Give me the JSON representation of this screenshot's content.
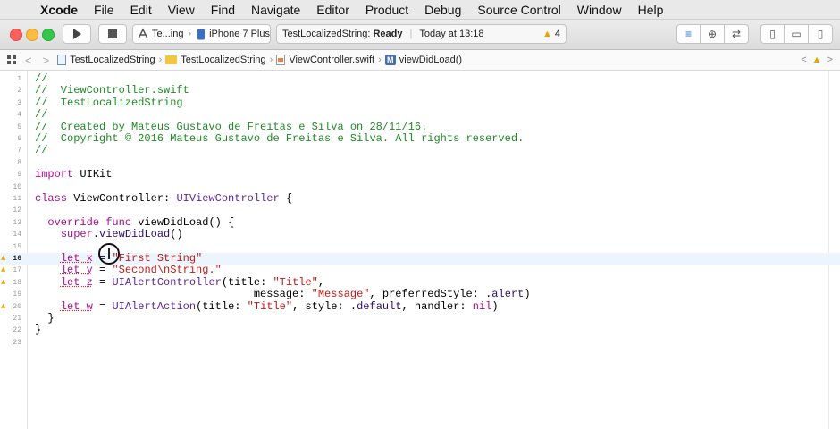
{
  "menubar": {
    "apple_glyph": "",
    "app": "Xcode",
    "items": [
      "File",
      "Edit",
      "View",
      "Find",
      "Navigate",
      "Editor",
      "Product",
      "Debug",
      "Source Control",
      "Window",
      "Help"
    ]
  },
  "toolbar": {
    "scheme": "Te...ing",
    "device": "iPhone 7 Plus",
    "status_project": "TestLocalizedString:",
    "status_state": "Ready",
    "status_time": "Today at 13:18",
    "warning_count": "4"
  },
  "jumpbar": {
    "crumbs": [
      "TestLocalizedString",
      "TestLocalizedString",
      "ViewController.swift",
      "viewDidLoad()"
    ],
    "method_icon_letter": "M",
    "back_glyph": "<",
    "forward_glyph": ">"
  },
  "editor": {
    "lines": [
      {
        "n": "1",
        "segs": [
          {
            "t": "//",
            "c": "com"
          }
        ]
      },
      {
        "n": "2",
        "segs": [
          {
            "t": "//  ViewController.swift",
            "c": "com"
          }
        ]
      },
      {
        "n": "3",
        "segs": [
          {
            "t": "//  TestLocalizedString",
            "c": "com"
          }
        ]
      },
      {
        "n": "4",
        "segs": [
          {
            "t": "//",
            "c": "com"
          }
        ]
      },
      {
        "n": "5",
        "segs": [
          {
            "t": "//  Created by Mateus Gustavo de Freitas e Silva on 28/11/16.",
            "c": "com"
          }
        ]
      },
      {
        "n": "6",
        "segs": [
          {
            "t": "//  Copyright © 2016 Mateus Gustavo de Freitas e Silva. All rights reserved.",
            "c": "com"
          }
        ]
      },
      {
        "n": "7",
        "segs": [
          {
            "t": "//",
            "c": "com"
          }
        ]
      },
      {
        "n": "8",
        "segs": []
      },
      {
        "n": "9",
        "segs": [
          {
            "t": "import",
            "c": "kw"
          },
          {
            "t": " UIKit",
            "c": ""
          }
        ]
      },
      {
        "n": "10",
        "segs": []
      },
      {
        "n": "11",
        "segs": [
          {
            "t": "class",
            "c": "kw"
          },
          {
            "t": " ViewController: ",
            "c": ""
          },
          {
            "t": "UIViewController",
            "c": "type"
          },
          {
            "t": " {",
            "c": ""
          }
        ]
      },
      {
        "n": "12",
        "segs": []
      },
      {
        "n": "13",
        "segs": [
          {
            "t": "  ",
            "c": ""
          },
          {
            "t": "override",
            "c": "kw"
          },
          {
            "t": " ",
            "c": ""
          },
          {
            "t": "func",
            "c": "kw"
          },
          {
            "t": " viewDidLoad() {",
            "c": ""
          }
        ]
      },
      {
        "n": "14",
        "segs": [
          {
            "t": "    ",
            "c": ""
          },
          {
            "t": "super",
            "c": "kw"
          },
          {
            "t": ".",
            "c": ""
          },
          {
            "t": "viewDidLoad",
            "c": "fn"
          },
          {
            "t": "()",
            "c": ""
          }
        ]
      },
      {
        "n": "15",
        "segs": []
      },
      {
        "n": "16",
        "warn": true,
        "cur": true,
        "segs": [
          {
            "t": "    ",
            "c": ""
          },
          {
            "t": "let x",
            "c": "kw sq"
          },
          {
            "t": " = ",
            "c": ""
          },
          {
            "t": "\"First String\"",
            "c": "str"
          }
        ]
      },
      {
        "n": "17",
        "warn": true,
        "segs": [
          {
            "t": "    ",
            "c": ""
          },
          {
            "t": "let y",
            "c": "kw sq"
          },
          {
            "t": " = ",
            "c": ""
          },
          {
            "t": "\"Second\\nString.\"",
            "c": "str"
          }
        ]
      },
      {
        "n": "18",
        "warn": true,
        "segs": [
          {
            "t": "    ",
            "c": ""
          },
          {
            "t": "let z",
            "c": "kw sq"
          },
          {
            "t": " = ",
            "c": ""
          },
          {
            "t": "UIAlertController",
            "c": "type"
          },
          {
            "t": "(title: ",
            "c": ""
          },
          {
            "t": "\"Title\"",
            "c": "str"
          },
          {
            "t": ",",
            "c": ""
          }
        ]
      },
      {
        "n": "19",
        "segs": [
          {
            "t": "                                  message: ",
            "c": ""
          },
          {
            "t": "\"Message\"",
            "c": "str"
          },
          {
            "t": ", preferredStyle: .",
            "c": ""
          },
          {
            "t": "alert",
            "c": "fn"
          },
          {
            "t": ")",
            "c": ""
          }
        ]
      },
      {
        "n": "20",
        "warn": true,
        "segs": [
          {
            "t": "    ",
            "c": ""
          },
          {
            "t": "let w",
            "c": "kw sq"
          },
          {
            "t": " = ",
            "c": ""
          },
          {
            "t": "UIAlertAction",
            "c": "type"
          },
          {
            "t": "(title: ",
            "c": ""
          },
          {
            "t": "\"Title\"",
            "c": "str"
          },
          {
            "t": ", style: .",
            "c": ""
          },
          {
            "t": "default",
            "c": "fn"
          },
          {
            "t": ", handler: ",
            "c": ""
          },
          {
            "t": "nil",
            "c": "kw"
          },
          {
            "t": ")",
            "c": ""
          }
        ]
      },
      {
        "n": "21",
        "segs": [
          {
            "t": "  }",
            "c": ""
          }
        ]
      },
      {
        "n": "22",
        "segs": [
          {
            "t": "}",
            "c": ""
          }
        ]
      },
      {
        "n": "23",
        "segs": []
      }
    ]
  }
}
